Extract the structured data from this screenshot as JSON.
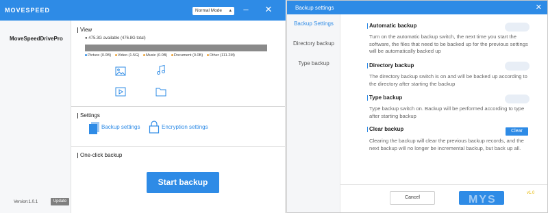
{
  "left": {
    "brand": "MOVESPEED",
    "mode": "Normal Mode",
    "device": "MoveSpeedDrivePro",
    "version": "Version:1.0.1",
    "update": "Update",
    "view": {
      "title": "View",
      "available": "475.3G available (476.8G total)",
      "legend": [
        {
          "label": "Picture (0.0B)",
          "color": "#2e8be6"
        },
        {
          "label": "Video (1.5G)",
          "color": "#e9a23b"
        },
        {
          "label": "Music (0.0B)",
          "color": "#e9a23b"
        },
        {
          "label": "Document (0.0B)",
          "color": "#e9a23b"
        },
        {
          "label": "Other (111.2M)",
          "color": "#e9a23b"
        }
      ]
    },
    "settings": {
      "title": "Settings",
      "backup": "Backup settings",
      "encryption": "Encryption settings"
    },
    "oneclick": {
      "title": "One-click backup",
      "start": "Start backup"
    }
  },
  "right": {
    "title": "Backup settings",
    "nav": [
      "Backup Settings",
      "Directory backup",
      "Type backup"
    ],
    "options": [
      {
        "title": "Automatic backup",
        "desc": "Turn on the automatic backup switch, the next time you start the software, the files that need to be backed up for the previous settings will be automatically backed up"
      },
      {
        "title": "Directory backup",
        "desc": "The directory backup switch is on and will be backed up according to the directory after starting the backup"
      },
      {
        "title": "Type backup",
        "desc": "Type backup switch on. Backup will be performed according to type after starting backup"
      },
      {
        "title": "Clear backup",
        "desc": "Clearing the backup will clear the previous backup records, and the next backup will no longer be incremental backup, but back up all."
      }
    ],
    "clear": "Clear",
    "cancel": "Cancel",
    "watermark": "MYS",
    "version_tag": "v1.0"
  }
}
